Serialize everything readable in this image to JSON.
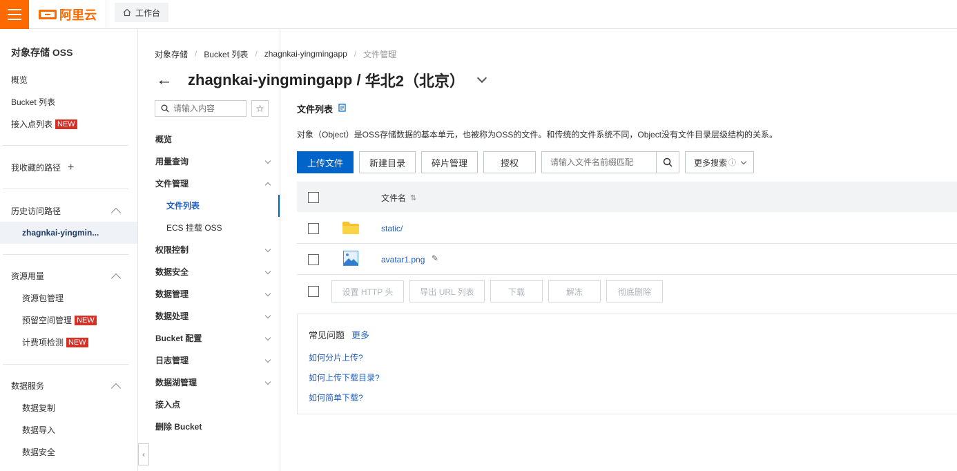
{
  "topbar": {
    "logo_text": "阿里云",
    "workbench_label": "工作台"
  },
  "sidebar": {
    "title": "对象存储 OSS",
    "items": [
      {
        "label": "概览"
      },
      {
        "label": "Bucket 列表"
      },
      {
        "label": "接入点列表",
        "badge": "NEW"
      }
    ],
    "favorites_label": "我收藏的路径",
    "history_label": "历史访问路径",
    "history_active": "zhagnkai-yingmin...",
    "resource_label": "资源用量",
    "resource_items": [
      {
        "label": "资源包管理"
      },
      {
        "label": "预留空间管理",
        "badge": "NEW"
      },
      {
        "label": "计费项检测",
        "badge": "NEW"
      }
    ],
    "data_service_label": "数据服务",
    "data_service_items": [
      {
        "label": "数据复制"
      },
      {
        "label": "数据导入"
      },
      {
        "label": "数据安全"
      }
    ]
  },
  "bucket_nav": {
    "search_placeholder": "请输入内容",
    "items": [
      {
        "label": "概览"
      },
      {
        "label": "用量查询"
      },
      {
        "label": "文件管理"
      },
      {
        "label": "文件列表"
      },
      {
        "label": "ECS 挂载 OSS"
      },
      {
        "label": "权限控制"
      },
      {
        "label": "数据安全"
      },
      {
        "label": "数据管理"
      },
      {
        "label": "数据处理"
      },
      {
        "label": "Bucket 配置"
      },
      {
        "label": "日志管理"
      },
      {
        "label": "数据湖管理"
      },
      {
        "label": "接入点"
      },
      {
        "label": "删除 Bucket"
      }
    ]
  },
  "breadcrumb": [
    "对象存储",
    "Bucket 列表",
    "zhagnkai-yingmingapp",
    "文件管理"
  ],
  "page": {
    "bucket_name": "zhagnkai-yingmingapp",
    "title_sep": " / ",
    "region": "华北2（北京）"
  },
  "main": {
    "title": "文件列表",
    "description": "对象（Object）是OSS存储数据的基本单元，也被称为OSS的文件。和传统的文件系统不同，Object没有文件目录层级结构的关系。",
    "buttons": {
      "upload": "上传文件",
      "new_dir": "新建目录",
      "fragments": "碎片管理",
      "authorize": "授权"
    },
    "file_search_placeholder": "请输入文件名前缀匹配",
    "more_search": "更多搜索",
    "table_header_name": "文件名",
    "files": [
      {
        "name": "static/",
        "type": "folder"
      },
      {
        "name": "avatar1.png",
        "type": "image"
      }
    ],
    "bulk_buttons": {
      "set_http": "设置 HTTP 头",
      "export_url": "导出 URL 列表",
      "download": "下载",
      "unfreeze": "解冻",
      "delete": "彻底删除"
    }
  },
  "faq": {
    "title": "常见问题",
    "more": "更多",
    "links": [
      "如何分片上传?",
      "如何上传下载目录?",
      "如何简单下载?"
    ]
  }
}
